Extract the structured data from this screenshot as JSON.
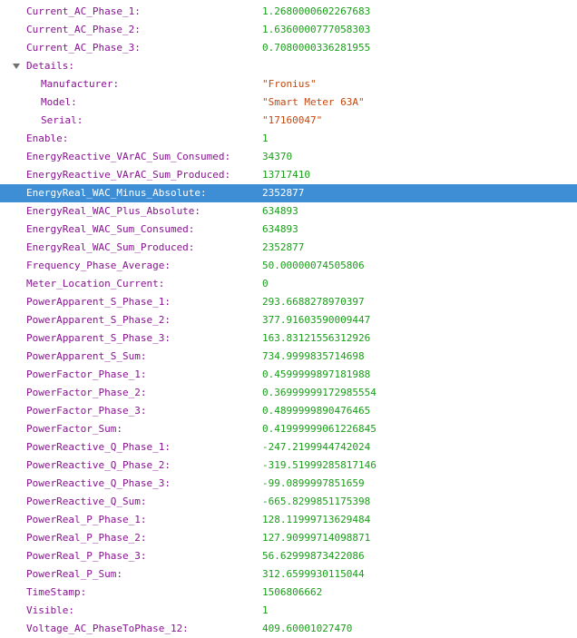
{
  "rows": [
    {
      "key": "Current_AC_Phase_1:",
      "value": "1.2680000602267683",
      "type": "number",
      "level": 0
    },
    {
      "key": "Current_AC_Phase_2:",
      "value": "1.6360000777058303",
      "type": "number",
      "level": 0
    },
    {
      "key": "Current_AC_Phase_3:",
      "value": "0.7080000336281955",
      "type": "number",
      "level": 0
    },
    {
      "key": "Details:",
      "value": "",
      "type": "object",
      "level": 0,
      "expanded": true
    },
    {
      "key": "Manufacturer:",
      "value": "\"Fronius\"",
      "type": "string",
      "level": 1
    },
    {
      "key": "Model:",
      "value": "\"Smart Meter 63A\"",
      "type": "string",
      "level": 1
    },
    {
      "key": "Serial:",
      "value": "\"17160047\"",
      "type": "string",
      "level": 1
    },
    {
      "key": "Enable:",
      "value": "1",
      "type": "number",
      "level": 0
    },
    {
      "key": "EnergyReactive_VArAC_Sum_Consumed:",
      "value": "34370",
      "type": "number",
      "level": 0
    },
    {
      "key": "EnergyReactive_VArAC_Sum_Produced:",
      "value": "13717410",
      "type": "number",
      "level": 0
    },
    {
      "key": "EnergyReal_WAC_Minus_Absolute:",
      "value": "2352877",
      "type": "number",
      "level": 0,
      "selected": true
    },
    {
      "key": "EnergyReal_WAC_Plus_Absolute:",
      "value": "634893",
      "type": "number",
      "level": 0
    },
    {
      "key": "EnergyReal_WAC_Sum_Consumed:",
      "value": "634893",
      "type": "number",
      "level": 0
    },
    {
      "key": "EnergyReal_WAC_Sum_Produced:",
      "value": "2352877",
      "type": "number",
      "level": 0
    },
    {
      "key": "Frequency_Phase_Average:",
      "value": "50.00000074505806",
      "type": "number",
      "level": 0
    },
    {
      "key": "Meter_Location_Current:",
      "value": "0",
      "type": "number",
      "level": 0
    },
    {
      "key": "PowerApparent_S_Phase_1:",
      "value": "293.6688278970397",
      "type": "number",
      "level": 0
    },
    {
      "key": "PowerApparent_S_Phase_2:",
      "value": "377.91603590009447",
      "type": "number",
      "level": 0
    },
    {
      "key": "PowerApparent_S_Phase_3:",
      "value": "163.83121556312926",
      "type": "number",
      "level": 0
    },
    {
      "key": "PowerApparent_S_Sum:",
      "value": "734.9999835714698",
      "type": "number",
      "level": 0
    },
    {
      "key": "PowerFactor_Phase_1:",
      "value": "0.4599999897181988",
      "type": "number",
      "level": 0
    },
    {
      "key": "PowerFactor_Phase_2:",
      "value": "0.36999999172985554",
      "type": "number",
      "level": 0
    },
    {
      "key": "PowerFactor_Phase_3:",
      "value": "0.4899999890476465",
      "type": "number",
      "level": 0
    },
    {
      "key": "PowerFactor_Sum:",
      "value": "0.41999999061226845",
      "type": "number",
      "level": 0
    },
    {
      "key": "PowerReactive_Q_Phase_1:",
      "value": "-247.2199944742024",
      "type": "number",
      "level": 0
    },
    {
      "key": "PowerReactive_Q_Phase_2:",
      "value": "-319.51999285817146",
      "type": "number",
      "level": 0
    },
    {
      "key": "PowerReactive_Q_Phase_3:",
      "value": "-99.0899997851659",
      "type": "number",
      "level": 0
    },
    {
      "key": "PowerReactive_Q_Sum:",
      "value": "-665.8299851175398",
      "type": "number",
      "level": 0
    },
    {
      "key": "PowerReal_P_Phase_1:",
      "value": "128.11999713629484",
      "type": "number",
      "level": 0
    },
    {
      "key": "PowerReal_P_Phase_2:",
      "value": "127.90999714098871",
      "type": "number",
      "level": 0
    },
    {
      "key": "PowerReal_P_Phase_3:",
      "value": "56.62999873422086",
      "type": "number",
      "level": 0
    },
    {
      "key": "PowerReal_P_Sum:",
      "value": "312.6599930115044",
      "type": "number",
      "level": 0
    },
    {
      "key": "TimeStamp:",
      "value": "1506806662",
      "type": "number",
      "level": 0
    },
    {
      "key": "Visible:",
      "value": "1",
      "type": "number",
      "level": 0
    }
  ],
  "partial_row": {
    "key": "Voltage_AC_PhaseToPhase_12:",
    "value": "409.60001027470",
    "type": "number",
    "level": 0
  },
  "icons": {
    "expand_toggle": "triangle-down-icon"
  },
  "colors": {
    "key": "#881391",
    "number": "#1a9d1a",
    "string": "#c4470e",
    "selected_bg": "#3e8ed6"
  }
}
